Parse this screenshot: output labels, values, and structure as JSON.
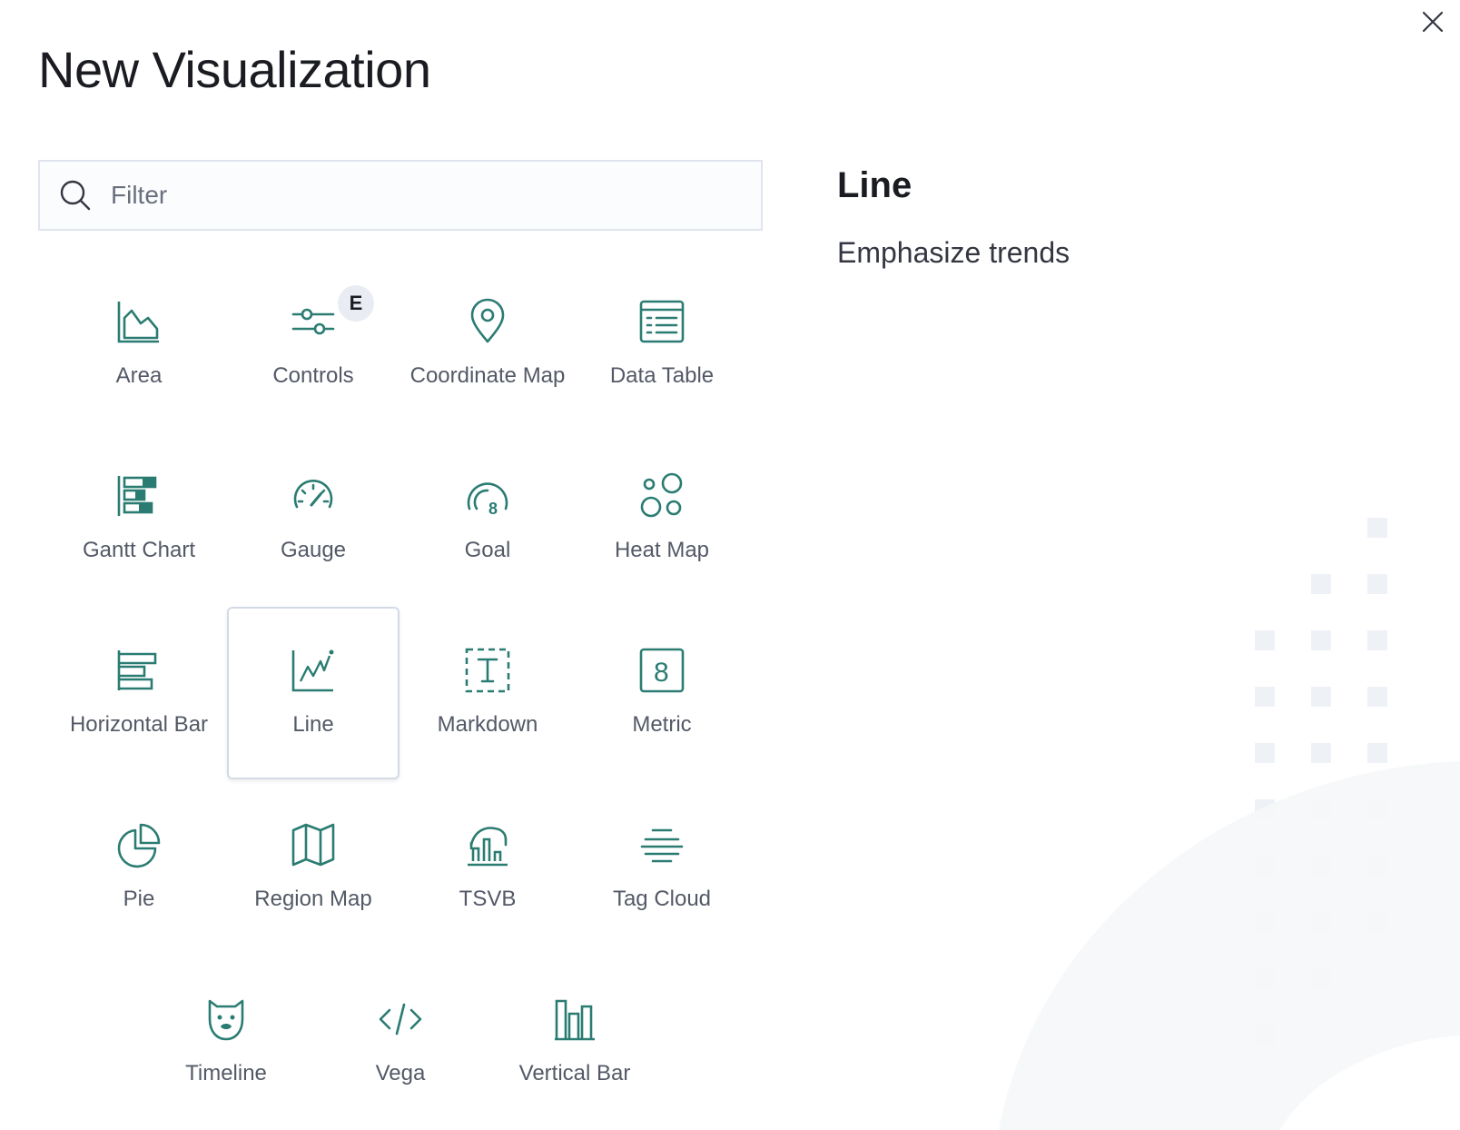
{
  "flyout": {
    "title": "New Visualization",
    "close_icon": "close-icon"
  },
  "search": {
    "placeholder": "Filter",
    "value": "",
    "icon": "search-icon"
  },
  "types": [
    {
      "label": "Area",
      "icon": "area-chart-icon"
    },
    {
      "label": "Controls",
      "icon": "sliders-icon",
      "badge": "E"
    },
    {
      "label": "Coordinate Map",
      "icon": "map-pin-icon"
    },
    {
      "label": "Data Table",
      "icon": "table-icon"
    },
    {
      "label": "Gantt Chart",
      "icon": "gantt-icon"
    },
    {
      "label": "Gauge",
      "icon": "gauge-icon"
    },
    {
      "label": "Goal",
      "icon": "goal-icon"
    },
    {
      "label": "Heat Map",
      "icon": "heatmap-icon"
    },
    {
      "label": "Horizontal Bar",
      "icon": "horizontal-bar-icon"
    },
    {
      "label": "Line",
      "icon": "line-chart-icon",
      "selected": true
    },
    {
      "label": "Markdown",
      "icon": "markdown-icon"
    },
    {
      "label": "Metric",
      "icon": "metric-icon"
    },
    {
      "label": "Pie",
      "icon": "pie-chart-icon"
    },
    {
      "label": "Region Map",
      "icon": "region-map-icon"
    },
    {
      "label": "TSVB",
      "icon": "tsvb-icon"
    },
    {
      "label": "Tag Cloud",
      "icon": "tag-cloud-icon"
    },
    {
      "label": "Timeline",
      "icon": "timeline-icon"
    },
    {
      "label": "Vega",
      "icon": "code-icon"
    },
    {
      "label": "Vertical Bar",
      "icon": "vertical-bar-icon"
    }
  ],
  "description": {
    "title": "Line",
    "text": "Emphasize trends"
  },
  "colors": {
    "icon": "#2a7c72",
    "label": "#535966",
    "border": "#d3dae6",
    "decoration": "#eef1f6"
  }
}
